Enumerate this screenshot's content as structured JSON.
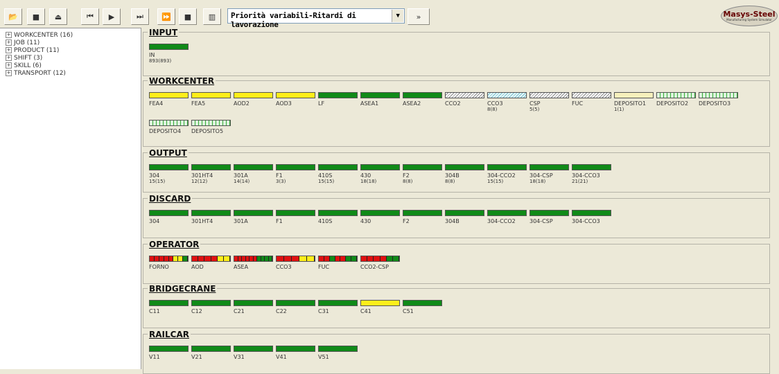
{
  "toolbar": {
    "buttons": [
      "open-folder-icon",
      "save-icon",
      "eject-icon",
      "rewind-start-icon",
      "play-icon",
      "step-icon",
      "fast-forward-icon",
      "stop-icon",
      "chart-icon"
    ],
    "combo_value": "Priorità variabili-Ritardi di lavorazione",
    "more_label": "»",
    "logo_text": "Masys-Steel",
    "logo_sub": "Manufacturing System Simulator"
  },
  "tree": [
    {
      "label": "WORKCENTER (16)"
    },
    {
      "label": "JOB (11)"
    },
    {
      "label": "PRODUCT (11)"
    },
    {
      "label": "SHIFT (3)"
    },
    {
      "label": "SKILL (6)"
    },
    {
      "label": "TRANSPORT (12)"
    }
  ],
  "colors": {
    "green": "#108a18",
    "yellow": "#ffee1a",
    "red": "#e01010"
  },
  "sections": {
    "input": {
      "title": "INPUT",
      "items": [
        {
          "name": "IN",
          "sub": "893(893)",
          "state": "green"
        }
      ]
    },
    "workcenter": {
      "title": "WORKCENTER",
      "items": [
        {
          "name": "FEA4",
          "sub": "",
          "state": "yellow"
        },
        {
          "name": "FEA5",
          "sub": "",
          "state": "yellow"
        },
        {
          "name": "AOD2",
          "sub": "",
          "state": "yellow"
        },
        {
          "name": "AOD3",
          "sub": "",
          "state": "yellow"
        },
        {
          "name": "LF",
          "sub": "",
          "state": "green"
        },
        {
          "name": "ASEA1",
          "sub": "",
          "state": "green"
        },
        {
          "name": "ASEA2",
          "sub": "",
          "state": "green"
        },
        {
          "name": "CCO2",
          "sub": "",
          "state": "hatch"
        },
        {
          "name": "CCO3",
          "sub": "8(8)",
          "state": "hatch-cyan"
        },
        {
          "name": "CSP",
          "sub": "5(5)",
          "state": "hatch"
        },
        {
          "name": "FUC",
          "sub": "",
          "state": "hatch"
        },
        {
          "name": "DEPOSITO1",
          "sub": "1(1)",
          "state": "cream"
        },
        {
          "name": "DEPOSITO2",
          "sub": "",
          "state": "grid-green"
        },
        {
          "name": "DEPOSITO3",
          "sub": "",
          "state": "grid-green"
        },
        {
          "name": "DEPOSITO4",
          "sub": "",
          "state": "grid-green"
        },
        {
          "name": "DEPOSITO5",
          "sub": "",
          "state": "grid-green"
        }
      ]
    },
    "output": {
      "title": "OUTPUT",
      "items": [
        {
          "name": "304",
          "sub": "15(15)"
        },
        {
          "name": "301HT4",
          "sub": "12(12)"
        },
        {
          "name": "301A",
          "sub": "14(14)"
        },
        {
          "name": "F1",
          "sub": "3(3)"
        },
        {
          "name": "410S",
          "sub": "15(15)"
        },
        {
          "name": "430",
          "sub": "18(18)"
        },
        {
          "name": "F2",
          "sub": "8(8)"
        },
        {
          "name": "304B",
          "sub": "8(8)"
        },
        {
          "name": "304-CCO2",
          "sub": "15(15)"
        },
        {
          "name": "304-CSP",
          "sub": "18(18)"
        },
        {
          "name": "304-CCO3",
          "sub": "21(21)"
        }
      ]
    },
    "discard": {
      "title": "DISCARD",
      "items": [
        {
          "name": "304"
        },
        {
          "name": "301HT4"
        },
        {
          "name": "301A"
        },
        {
          "name": "F1"
        },
        {
          "name": "410S"
        },
        {
          "name": "430"
        },
        {
          "name": "F2"
        },
        {
          "name": "304B"
        },
        {
          "name": "304-CCO2"
        },
        {
          "name": "304-CSP"
        },
        {
          "name": "304-CCO3"
        }
      ]
    },
    "operator": {
      "title": "OPERATOR",
      "items": [
        {
          "name": "FORNO",
          "segments": [
            "red",
            "red",
            "red",
            "red",
            "red",
            "yellow",
            "yellow",
            "green"
          ]
        },
        {
          "name": "AOD",
          "segments": [
            "red",
            "red",
            "red",
            "red",
            "yellow",
            "yellow"
          ]
        },
        {
          "name": "ASEA",
          "segments": [
            "red",
            "red",
            "red",
            "red",
            "red",
            "red",
            "green",
            "green",
            "green",
            "green"
          ]
        },
        {
          "name": "CCO3",
          "segments": [
            "red",
            "red",
            "red",
            "yellow",
            "yellow"
          ]
        },
        {
          "name": "FUC",
          "segments": [
            "red",
            "red",
            "green",
            "red",
            "red",
            "green",
            "green"
          ]
        },
        {
          "name": "CCO2-CSP",
          "segments": [
            "red",
            "red",
            "red",
            "red",
            "green",
            "green"
          ]
        }
      ]
    },
    "bridgecrane": {
      "title": "BRIDGECRANE",
      "items": [
        {
          "name": "C11",
          "state": "green"
        },
        {
          "name": "C12",
          "state": "green"
        },
        {
          "name": "C21",
          "state": "green"
        },
        {
          "name": "C22",
          "state": "green"
        },
        {
          "name": "C31",
          "state": "green"
        },
        {
          "name": "C41",
          "state": "yellow"
        },
        {
          "name": "C51",
          "state": "green"
        }
      ]
    },
    "railcar": {
      "title": "RAILCAR",
      "items": [
        {
          "name": "V11"
        },
        {
          "name": "V21"
        },
        {
          "name": "V31"
        },
        {
          "name": "V41"
        },
        {
          "name": "V51"
        }
      ]
    }
  }
}
